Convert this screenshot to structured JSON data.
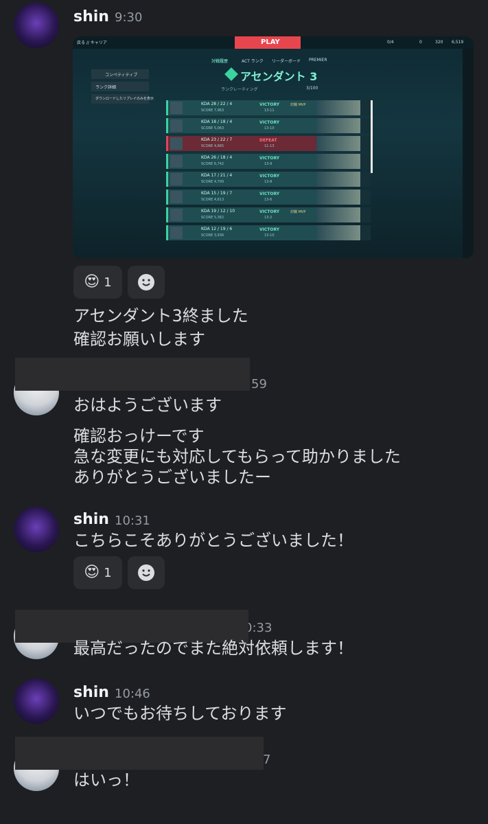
{
  "messages": [
    {
      "user": "shin",
      "time": "9:30",
      "lines": [
        "アセンダント3終ました",
        "確認お願いします"
      ],
      "reaction_count": "1"
    },
    {
      "time_partial": "59",
      "lines": [
        "おはようございます"
      ],
      "lines2": [
        "確認おっけーです",
        "急な変更にも対応してもらって助かりました",
        "ありがとうございましたー"
      ]
    },
    {
      "user": "shin",
      "time": "10:31",
      "lines": [
        "こちらこそありがとうございました！"
      ],
      "reaction_count": "1"
    },
    {
      "time_partial": "0:33",
      "lines": [
        "最高だったのでまた絶対依頼します！"
      ]
    },
    {
      "user": "shin",
      "time": "10:46",
      "lines": [
        "いつでもお待ちしております"
      ]
    },
    {
      "time_partial": "7",
      "lines": [
        "はいっ！"
      ]
    }
  ],
  "screenshot": {
    "top_nav": [
      "戻る // キャリア",
      "PLAY"
    ],
    "top_right": [
      "0/4",
      "0",
      "320",
      "6,519"
    ],
    "tabs": [
      "対戦履歴",
      "ACT ランク",
      "リーダーボード",
      "PREMIER"
    ],
    "left_menu": [
      "コンペティティブ",
      "ランク詳細",
      "ダウンロードしたリプレイのみを表示"
    ],
    "rank_title": "アセンダント 3",
    "rank_sub": "ランクレーティング",
    "rank_points": "3/100",
    "matches": [
      {
        "kda": "KDA 28 / 22 / 4",
        "score": "SCORE 7,963",
        "result": "VICTORY",
        "sc": "13-11",
        "mvp": "対戦 MVP"
      },
      {
        "kda": "KDA 18 / 18 / 4",
        "score": "SCORE 5,063",
        "result": "VICTORY",
        "sc": "13-10",
        "mvp": ""
      },
      {
        "kda": "KDA 23 / 22 / 7",
        "score": "SCORE 4,665",
        "result": "DEFEAT",
        "sc": "11-13",
        "mvp": ""
      },
      {
        "kda": "KDA 26 / 18 / 4",
        "score": "SCORE 6,742",
        "result": "VICTORY",
        "sc": "13-9",
        "mvp": ""
      },
      {
        "kda": "KDA 17 / 21 / 4",
        "score": "SCORE 4,700",
        "result": "VICTORY",
        "sc": "13-8",
        "mvp": ""
      },
      {
        "kda": "KDA 15 / 19 / 7",
        "score": "SCORE 4,613",
        "result": "VICTORY",
        "sc": "13-6",
        "mvp": ""
      },
      {
        "kda": "KDA 19 / 12 / 10",
        "score": "SCORE 5,382",
        "result": "VICTORY",
        "sc": "13-2",
        "mvp": "対戦 MVP"
      },
      {
        "kda": "KDA 12 / 19 / 6",
        "score": "SCORE 3,936",
        "result": "VICTORY",
        "sc": "13-10",
        "mvp": ""
      }
    ]
  }
}
